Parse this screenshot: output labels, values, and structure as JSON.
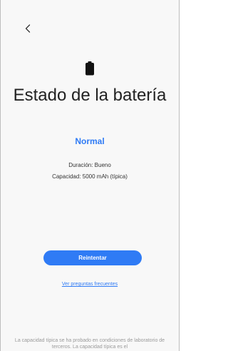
{
  "header": {
    "back_icon": "chevron-left-icon"
  },
  "main": {
    "battery_icon": "battery-icon",
    "title": "Estado de la batería",
    "status": "Normal",
    "status_color": "#2f7bf5",
    "duration": "Duración: Bueno",
    "capacity": "Capacidad: 5000 mAh (típica)",
    "retry_button": "Reintentar",
    "faq_link": "Ver preguntas frecuentes",
    "footnote": "La capacidad típica se ha probado en condiciones de laboratorio de terceros. La capacidad típica es el"
  },
  "colors": {
    "accent": "#2f7bf5",
    "background": "#f8f8f8",
    "footnote_text": "#9a9a9a"
  }
}
